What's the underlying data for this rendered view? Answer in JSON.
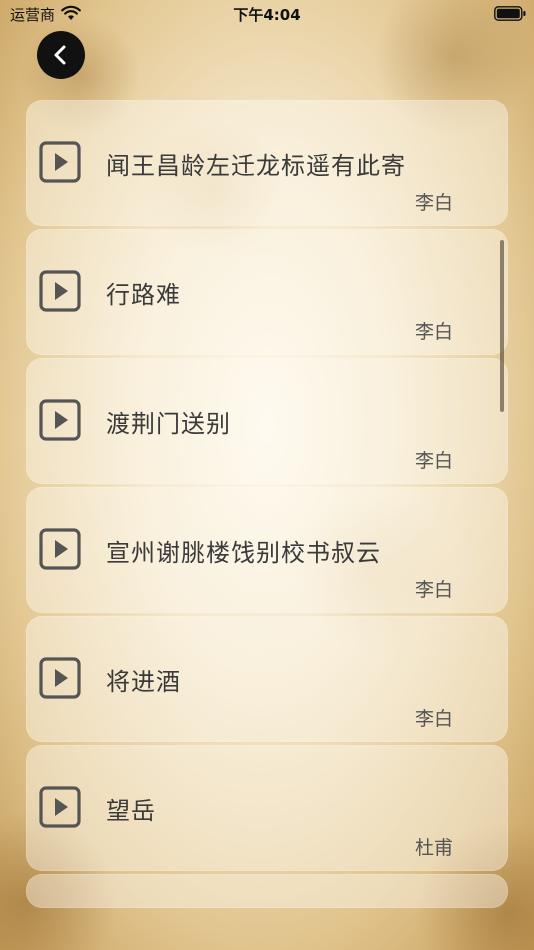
{
  "status_bar": {
    "carrier": "运营商",
    "time": "下午4:04"
  },
  "navigation": {
    "back_icon": "chevron-left-icon"
  },
  "poems": [
    {
      "title": "闻王昌龄左迁龙标遥有此寄",
      "author": "李白"
    },
    {
      "title": "行路难",
      "author": "李白"
    },
    {
      "title": "渡荆门送别",
      "author": "李白"
    },
    {
      "title": "宣州谢朓楼饯别校书叔云",
      "author": "李白"
    },
    {
      "title": "将进酒",
      "author": "李白"
    },
    {
      "title": "望岳",
      "author": "杜甫"
    }
  ],
  "colors": {
    "icon": "#555555",
    "title_text": "#3a3a3a",
    "back_button_bg": "#111111"
  }
}
